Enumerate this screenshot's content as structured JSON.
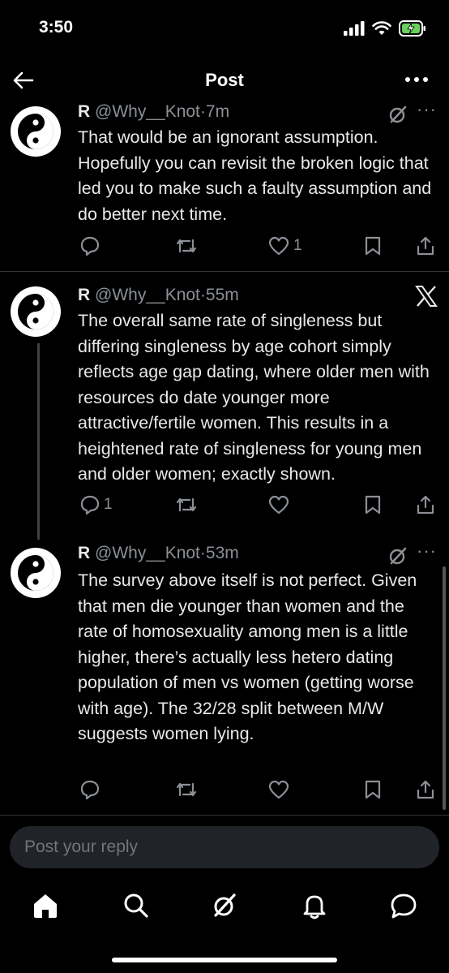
{
  "status_bar": {
    "time": "3:50"
  },
  "header": {
    "title": "Post",
    "back_icon": "arrow-left-icon",
    "more_icon": "more-horizontal-icon"
  },
  "posts": [
    {
      "name": "R",
      "handle": "@Why__Knot",
      "separator": "·",
      "time": "7m",
      "text": "That would be an ignorant assumption. Hopefully you can revisit the broken logic that led you to make such a faulty assumption and do better next time.",
      "reply_count": "",
      "repost_count": "",
      "like_count": "1",
      "corner_icon": "grok-icon"
    },
    {
      "name": "R",
      "handle": "@Why__Knot",
      "separator": "·",
      "time": "55m",
      "text": "The overall same rate of singleness but differing singleness by age cohort simply reflects age gap dating, where older men with resources do date younger more attractive/fertile women. This results in a heightened rate of singleness for young men and older women; exactly shown.",
      "reply_count": "1",
      "repost_count": "",
      "like_count": "",
      "corner_icon": "x-logo-icon"
    },
    {
      "name": "R",
      "handle": "@Why__Knot",
      "separator": "·",
      "time": "53m",
      "text": "The survey above itself is not perfect. Given that men die younger than women and the rate of homosexuality among men is a little higher, there’s actually less hetero dating population of men vs women (getting worse with age). The 32/28 split between M/W suggests women lying.",
      "reply_count": "",
      "repost_count": "",
      "like_count": "",
      "corner_icon": "grok-icon"
    }
  ],
  "reply": {
    "placeholder": "Post your reply"
  },
  "bottom_nav": [
    "home-icon",
    "search-icon",
    "grok-icon",
    "notifications-icon",
    "messages-icon"
  ],
  "colors": {
    "background": "#000000",
    "text": "#e7e9ea",
    "muted": "#8b9096",
    "divider": "#2f3336"
  }
}
